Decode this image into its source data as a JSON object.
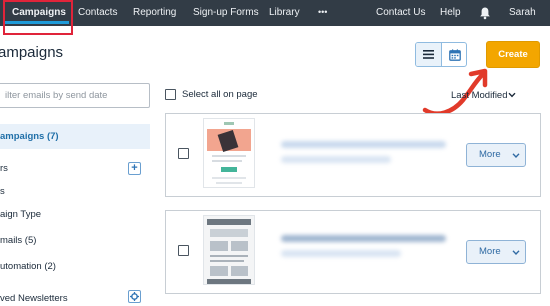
{
  "nav": {
    "items": [
      "Campaigns",
      "Contacts",
      "Reporting",
      "Sign-up Forms",
      "Library"
    ],
    "more": "•••",
    "right": [
      "Contact Us",
      "Help"
    ],
    "user": "Sarah"
  },
  "header": {
    "title": "ampaigns",
    "create": "Create"
  },
  "sidebar": {
    "filter_placeholder": "ilter emails by send date",
    "items": [
      {
        "label": "ampaigns (7)",
        "active": true
      },
      {
        "label": "rs"
      },
      {
        "label": "s"
      },
      {
        "label": "aign Type"
      },
      {
        "label": "mails (5)"
      },
      {
        "label": "utomation (2)"
      },
      {
        "label": "ved Newsletters"
      }
    ]
  },
  "list": {
    "select_all": "Select all on page",
    "sort_label": "Last Modified"
  },
  "cards": [
    {
      "more": "More"
    },
    {
      "more": "More"
    }
  ],
  "colors": {
    "nav_bg": "#323c46",
    "accent": "#1f9bd9",
    "create": "#f3a600",
    "highlight": "#e0243a"
  }
}
